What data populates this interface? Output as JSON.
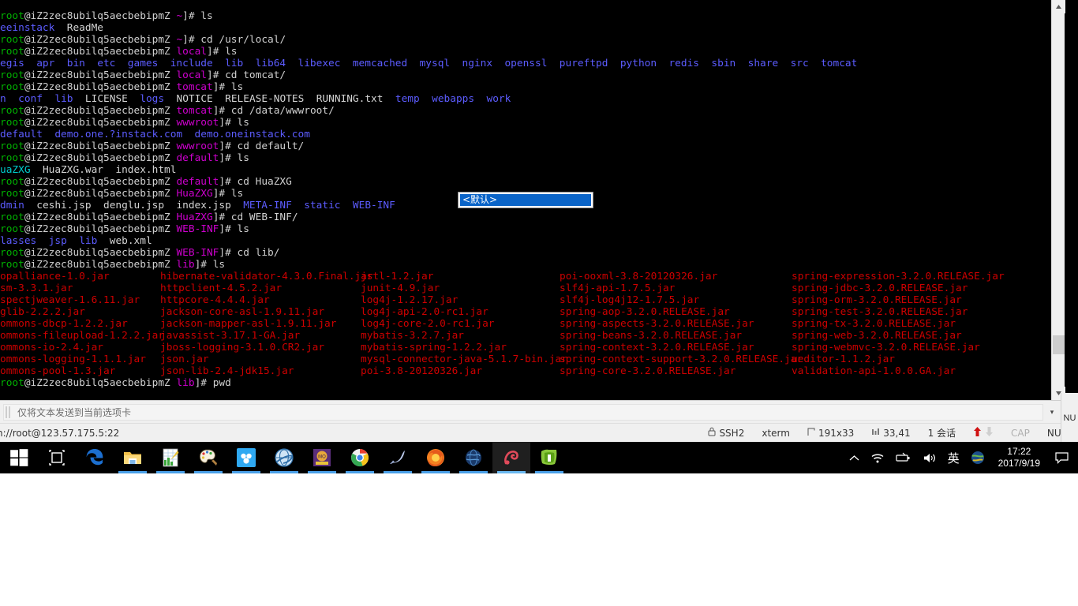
{
  "terminal": {
    "prompt_user": "root",
    "host": "@iZ2zec8ubilq5aecbebipmZ",
    "lines": [
      {
        "type": "prompt",
        "dir": "~",
        "dir_class": "c-dir",
        "cmd": "]# ls"
      },
      {
        "type": "out",
        "segs": [
          {
            "t": "eeinstack",
            "c": "c-blue"
          },
          {
            "t": "  ReadMe",
            "c": "c-white"
          }
        ]
      },
      {
        "type": "prompt",
        "dir": "~",
        "dir_class": "c-dir",
        "cmd": "]# cd /usr/local/"
      },
      {
        "type": "prompt",
        "dir": "local",
        "dir_class": "c-dir",
        "cmd": "]# ls"
      },
      {
        "type": "out",
        "segs": [
          {
            "t": "egis  apr  bin  etc  games  include  lib  lib64  libexec  memcached  mysql  nginx  openssl  pureftpd  python  redis  sbin  share  src  tomcat",
            "c": "c-blue"
          }
        ]
      },
      {
        "type": "prompt",
        "dir": "local",
        "dir_class": "c-dir",
        "cmd": "]# cd tomcat/"
      },
      {
        "type": "prompt",
        "dir": "tomcat",
        "dir_class": "c-dir",
        "cmd": "]# ls"
      },
      {
        "type": "out",
        "segs": [
          {
            "t": "n",
            "c": "c-blue"
          },
          {
            "t": "  ",
            "c": "c-white"
          },
          {
            "t": "conf",
            "c": "c-blue"
          },
          {
            "t": "  ",
            "c": "c-white"
          },
          {
            "t": "lib",
            "c": "c-blue"
          },
          {
            "t": "  LICENSE  ",
            "c": "c-white"
          },
          {
            "t": "logs",
            "c": "c-blue"
          },
          {
            "t": "  NOTICE  RELEASE-NOTES  RUNNING.txt  ",
            "c": "c-white"
          },
          {
            "t": "temp",
            "c": "c-blue"
          },
          {
            "t": "  ",
            "c": "c-white"
          },
          {
            "t": "webapps",
            "c": "c-blue"
          },
          {
            "t": "  ",
            "c": "c-white"
          },
          {
            "t": "work",
            "c": "c-blue"
          }
        ]
      },
      {
        "type": "prompt",
        "dir": "tomcat",
        "dir_class": "c-dir",
        "cmd": "]# cd /data/wwwroot/"
      },
      {
        "type": "prompt",
        "dir": "wwwroot",
        "dir_class": "c-dir",
        "cmd": "]# ls"
      },
      {
        "type": "out",
        "segs": [
          {
            "t": "default  demo.one.?instack.com  demo.oneinstack.com",
            "c": "c-blue"
          }
        ]
      },
      {
        "type": "prompt",
        "dir": "wwwroot",
        "dir_class": "c-dir",
        "cmd": "]# cd default/"
      },
      {
        "type": "prompt",
        "dir": "default",
        "dir_class": "c-dir",
        "cmd": "]# ls"
      },
      {
        "type": "out",
        "segs": [
          {
            "t": "uaZXG",
            "c": "c-cyan"
          },
          {
            "t": "  HuaZXG.war  index.html",
            "c": "c-white"
          }
        ]
      },
      {
        "type": "prompt",
        "dir": "default",
        "dir_class": "c-dir",
        "cmd": "]# cd HuaZXG"
      },
      {
        "type": "prompt",
        "dir": "HuaZXG",
        "dir_class": "c-dir",
        "cmd": "]# ls"
      },
      {
        "type": "out",
        "segs": [
          {
            "t": "dmin",
            "c": "c-blue"
          },
          {
            "t": "  ceshi.jsp  denglu.jsp  index.jsp  ",
            "c": "c-white"
          },
          {
            "t": "META-INF",
            "c": "c-blue"
          },
          {
            "t": "  ",
            "c": "c-white"
          },
          {
            "t": "static",
            "c": "c-blue"
          },
          {
            "t": "  ",
            "c": "c-white"
          },
          {
            "t": "WEB-INF",
            "c": "c-blue"
          }
        ]
      },
      {
        "type": "prompt",
        "dir": "HuaZXG",
        "dir_class": "c-dir",
        "cmd": "]# cd WEB-INF/"
      },
      {
        "type": "prompt",
        "dir": "WEB-INF",
        "dir_class": "c-dir",
        "cmd": "]# ls"
      },
      {
        "type": "out",
        "segs": [
          {
            "t": "lasses",
            "c": "c-blue"
          },
          {
            "t": "  ",
            "c": "c-white"
          },
          {
            "t": "jsp",
            "c": "c-blue"
          },
          {
            "t": "  ",
            "c": "c-white"
          },
          {
            "t": "lib",
            "c": "c-blue"
          },
          {
            "t": "  web.xml",
            "c": "c-white"
          }
        ]
      },
      {
        "type": "prompt",
        "dir": "WEB-INF",
        "dir_class": "c-dir",
        "cmd": "]# cd lib/"
      },
      {
        "type": "prompt",
        "dir": "lib",
        "dir_class": "c-dir",
        "cmd": "]# ls"
      }
    ],
    "jar_columns": [
      [
        "opalliance-1.0.jar",
        "sm-3.3.1.jar",
        "spectjweaver-1.6.11.jar",
        "glib-2.2.2.jar",
        "ommons-dbcp-1.2.2.jar",
        "ommons-fileupload-1.2.2.jar",
        "ommons-io-2.4.jar",
        "ommons-logging-1.1.1.jar",
        "ommons-pool-1.3.jar"
      ],
      [
        "hibernate-validator-4.3.0.Final.jar",
        "httpclient-4.5.2.jar",
        "httpcore-4.4.4.jar",
        "jackson-core-asl-1.9.11.jar",
        "jackson-mapper-asl-1.9.11.jar",
        "javassist-3.17.1-GA.jar",
        "jboss-logging-3.1.0.CR2.jar",
        "json.jar",
        "json-lib-2.4-jdk15.jar"
      ],
      [
        "jstl-1.2.jar",
        "junit-4.9.jar",
        "log4j-1.2.17.jar",
        "log4j-api-2.0-rc1.jar",
        "log4j-core-2.0-rc1.jar",
        "mybatis-3.2.7.jar",
        "mybatis-spring-1.2.2.jar",
        "mysql-connector-java-5.1.7-bin.jar",
        "poi-3.8-20120326.jar"
      ],
      [
        "poi-ooxml-3.8-20120326.jar",
        "slf4j-api-1.7.5.jar",
        "slf4j-log4j12-1.7.5.jar",
        "spring-aop-3.2.0.RELEASE.jar",
        "spring-aspects-3.2.0.RELEASE.jar",
        "spring-beans-3.2.0.RELEASE.jar",
        "spring-context-3.2.0.RELEASE.jar",
        "spring-context-support-3.2.0.RELEASE.jar",
        "spring-core-3.2.0.RELEASE.jar"
      ],
      [
        "spring-expression-3.2.0.RELEASE.jar",
        "spring-jdbc-3.2.0.RELEASE.jar",
        "spring-orm-3.2.0.RELEASE.jar",
        "spring-test-3.2.0.RELEASE.jar",
        "spring-tx-3.2.0.RELEASE.jar",
        "spring-web-3.2.0.RELEASE.jar",
        "spring-webmvc-3.2.0.RELEASE.jar",
        "ueditor-1.1.2.jar",
        "validation-api-1.0.0.GA.jar"
      ]
    ],
    "last_line": {
      "dir": "lib",
      "cmd": "]# pwd"
    }
  },
  "combo_popup": {
    "selected_option": "<默认>"
  },
  "send_bar": {
    "text": "仅将文本发送到当前选项卡",
    "caret": "▾",
    "menu": "☰"
  },
  "status_bar": {
    "session_address": "h://root@123.57.175.5:22",
    "protocol": "SSH2",
    "terminal_type": "xterm",
    "size": "191x33",
    "cursor": "33,41",
    "sessions": "1 会话",
    "cap": "CAP",
    "num": "NUM",
    "lock_icon": "🔒",
    "size_icon": "↱",
    "cursor_icon": "⇲"
  },
  "scrollbar": {
    "up_arrow": "▲",
    "down_arrow": "▼"
  },
  "taskbar": {
    "items": [
      {
        "name": "start-button",
        "label": "Windows Start",
        "state": "idle"
      },
      {
        "name": "task-view-button",
        "label": "Task View",
        "state": "idle"
      },
      {
        "name": "edge-button",
        "label": "Microsoft Edge",
        "state": "idle"
      },
      {
        "name": "file-explorer-button",
        "label": "File Explorer",
        "state": "open"
      },
      {
        "name": "excel-button",
        "label": "Excel",
        "state": "open"
      },
      {
        "name": "paint-button",
        "label": "Paint",
        "state": "open"
      },
      {
        "name": "baidu-netdisk-button",
        "label": "Baidu Netdisk",
        "state": "open"
      },
      {
        "name": "ie-button",
        "label": "Internet Explorer",
        "state": "open"
      },
      {
        "name": "mobile-ide-button",
        "label": "MobileIDE",
        "state": "open"
      },
      {
        "name": "chrome-button",
        "label": "Google Chrome",
        "state": "open"
      },
      {
        "name": "navicat-button",
        "label": "Navicat",
        "state": "open"
      },
      {
        "name": "firefox-button",
        "label": "Mozilla Firefox",
        "state": "open"
      },
      {
        "name": "globe-app-button",
        "label": "Browser",
        "state": "open"
      },
      {
        "name": "xshell-button",
        "label": "Xshell",
        "state": "active"
      },
      {
        "name": "notepadpp-button",
        "label": "Notepad++",
        "state": "open"
      }
    ],
    "tray": {
      "overflow": "⌃",
      "ime": "英",
      "time": "17:22",
      "date": "2017/9/19"
    }
  },
  "edge_fragment": {
    "label": "NU"
  },
  "colors": {
    "terminal_bg": "#000000",
    "prompt_green": "#00af00",
    "dir_magenta": "#cd00cd",
    "dir_blue": "#5c5cff",
    "jar_red": "#cd0000",
    "highlight_blue": "#0a64c8",
    "taskbar_bg": "#000000",
    "statusbar_bg": "#f0f0f0"
  }
}
